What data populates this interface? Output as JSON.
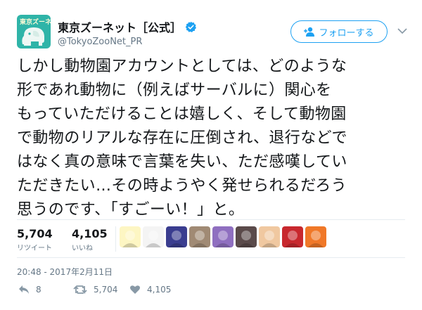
{
  "account": {
    "avatar_brand": "東京ズーネット",
    "display_name": "東京ズーネット［公式］",
    "handle": "@TokyoZooNet_PR"
  },
  "follow_button": {
    "label": "フォローする"
  },
  "tweet": {
    "lines": [
      "しかし動物園アカウントとしては、どのような",
      "形であれ動物に（例えばサーバルに）関心を",
      "もっていただけることは嬉しく、そして動物園",
      "で動物のリアルな存在に圧倒され、退行などで",
      "はなく真の意味で言葉を失い、ただ感嘆してい",
      "ただきたい…その時ようやく発せられるだろう",
      "思うのです、「すごーい！」と。"
    ]
  },
  "stats": {
    "retweets": {
      "count": "5,704",
      "label": "リツイート"
    },
    "likes": {
      "count": "4,105",
      "label": "いいね"
    }
  },
  "likers": [
    {
      "icon": "avatar-leaf-character-icon",
      "color": "#fdf6c3"
    },
    {
      "icon": "avatar-line-drawing-icon",
      "color": "#f4f4f4"
    },
    {
      "icon": "avatar-anime-blue-icon",
      "color": "#3a3d8f"
    },
    {
      "icon": "avatar-photo-icon",
      "color": "#a08a74"
    },
    {
      "icon": "avatar-anime-purple-icon",
      "color": "#8f6fc0"
    },
    {
      "icon": "avatar-anime-dark-icon",
      "color": "#5a4a4a"
    },
    {
      "icon": "avatar-anime-blonde-icon",
      "color": "#f0c8a0"
    },
    {
      "icon": "avatar-red-hat-icon",
      "color": "#c8282e"
    },
    {
      "icon": "avatar-orange-mascot-icon",
      "color": "#f07828"
    }
  ],
  "timestamp": "20:48 - 2017年2月11日",
  "actions": {
    "reply_count": "8",
    "retweet_count": "5,704",
    "like_count": "4,105"
  },
  "colors": {
    "accent": "#1da1f2",
    "secondary_text": "#657786",
    "avatar_bg": "#2fb4a8"
  }
}
